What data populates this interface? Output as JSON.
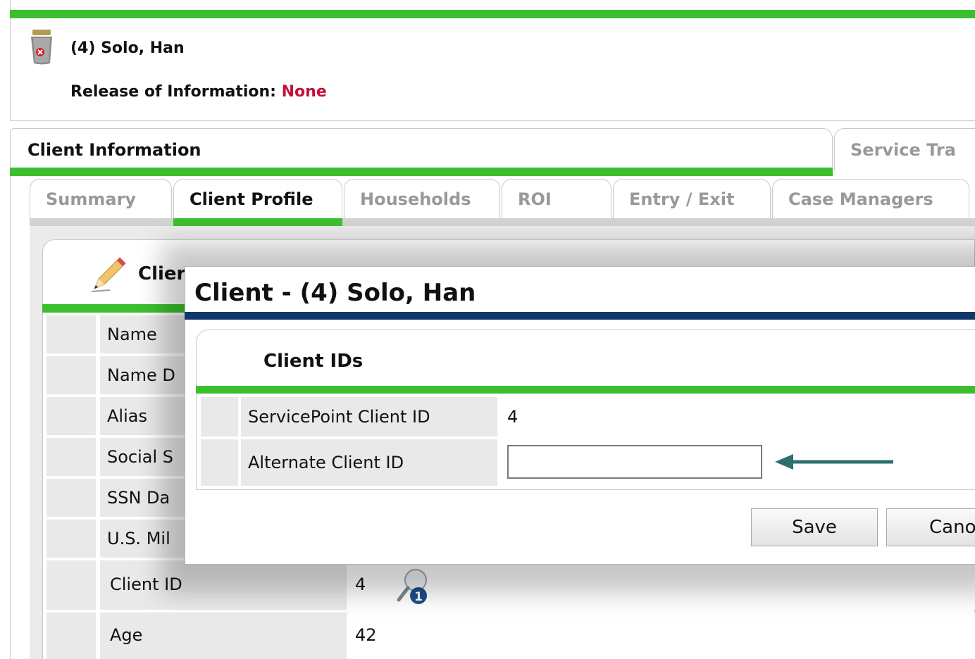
{
  "header": {
    "client_name": "(4) Solo, Han",
    "roi_label": "Release of Information: ",
    "roi_value": "None"
  },
  "main_tabs": [
    {
      "label": "Client Information",
      "active": true
    },
    {
      "label": "Service Tra",
      "active": false
    }
  ],
  "sub_tabs": [
    {
      "label": "Summary",
      "active": false
    },
    {
      "label": "Client Profile",
      "active": true
    },
    {
      "label": "Households",
      "active": false
    },
    {
      "label": "ROI",
      "active": false
    },
    {
      "label": "Entry / Exit",
      "active": false
    },
    {
      "label": "Case Managers",
      "active": false
    }
  ],
  "profile": {
    "title": "Clier",
    "rows": [
      {
        "label": "Name",
        "value": ""
      },
      {
        "label": "Name D",
        "value": ""
      },
      {
        "label": "Alias",
        "value": ""
      },
      {
        "label": "Social S",
        "value": ""
      },
      {
        "label": "SSN Da",
        "value": ""
      },
      {
        "label": "U.S. Mil",
        "value": ""
      },
      {
        "label": "Client ID",
        "value": "4"
      },
      {
        "label": "Age",
        "value": "42"
      }
    ]
  },
  "dialog": {
    "title": "Client - (4) Solo, Han",
    "section_title": "Client IDs",
    "servicepoint_id_label": "ServicePoint Client ID",
    "servicepoint_id_value": "4",
    "alternate_id_label": "Alternate Client ID",
    "alternate_id_value": "",
    "save_label": "Save",
    "cancel_label": "Cano"
  },
  "colors": {
    "accent_green": "#3cbf2f",
    "dialog_bar": "#10376c",
    "roi_none": "#c4103b",
    "arrow": "#2c7070"
  },
  "icons": {
    "client": "trash-can-icon",
    "edit": "pencil-icon",
    "search_badge": "magnifier-badge-icon",
    "arrow": "arrow-left-icon"
  }
}
